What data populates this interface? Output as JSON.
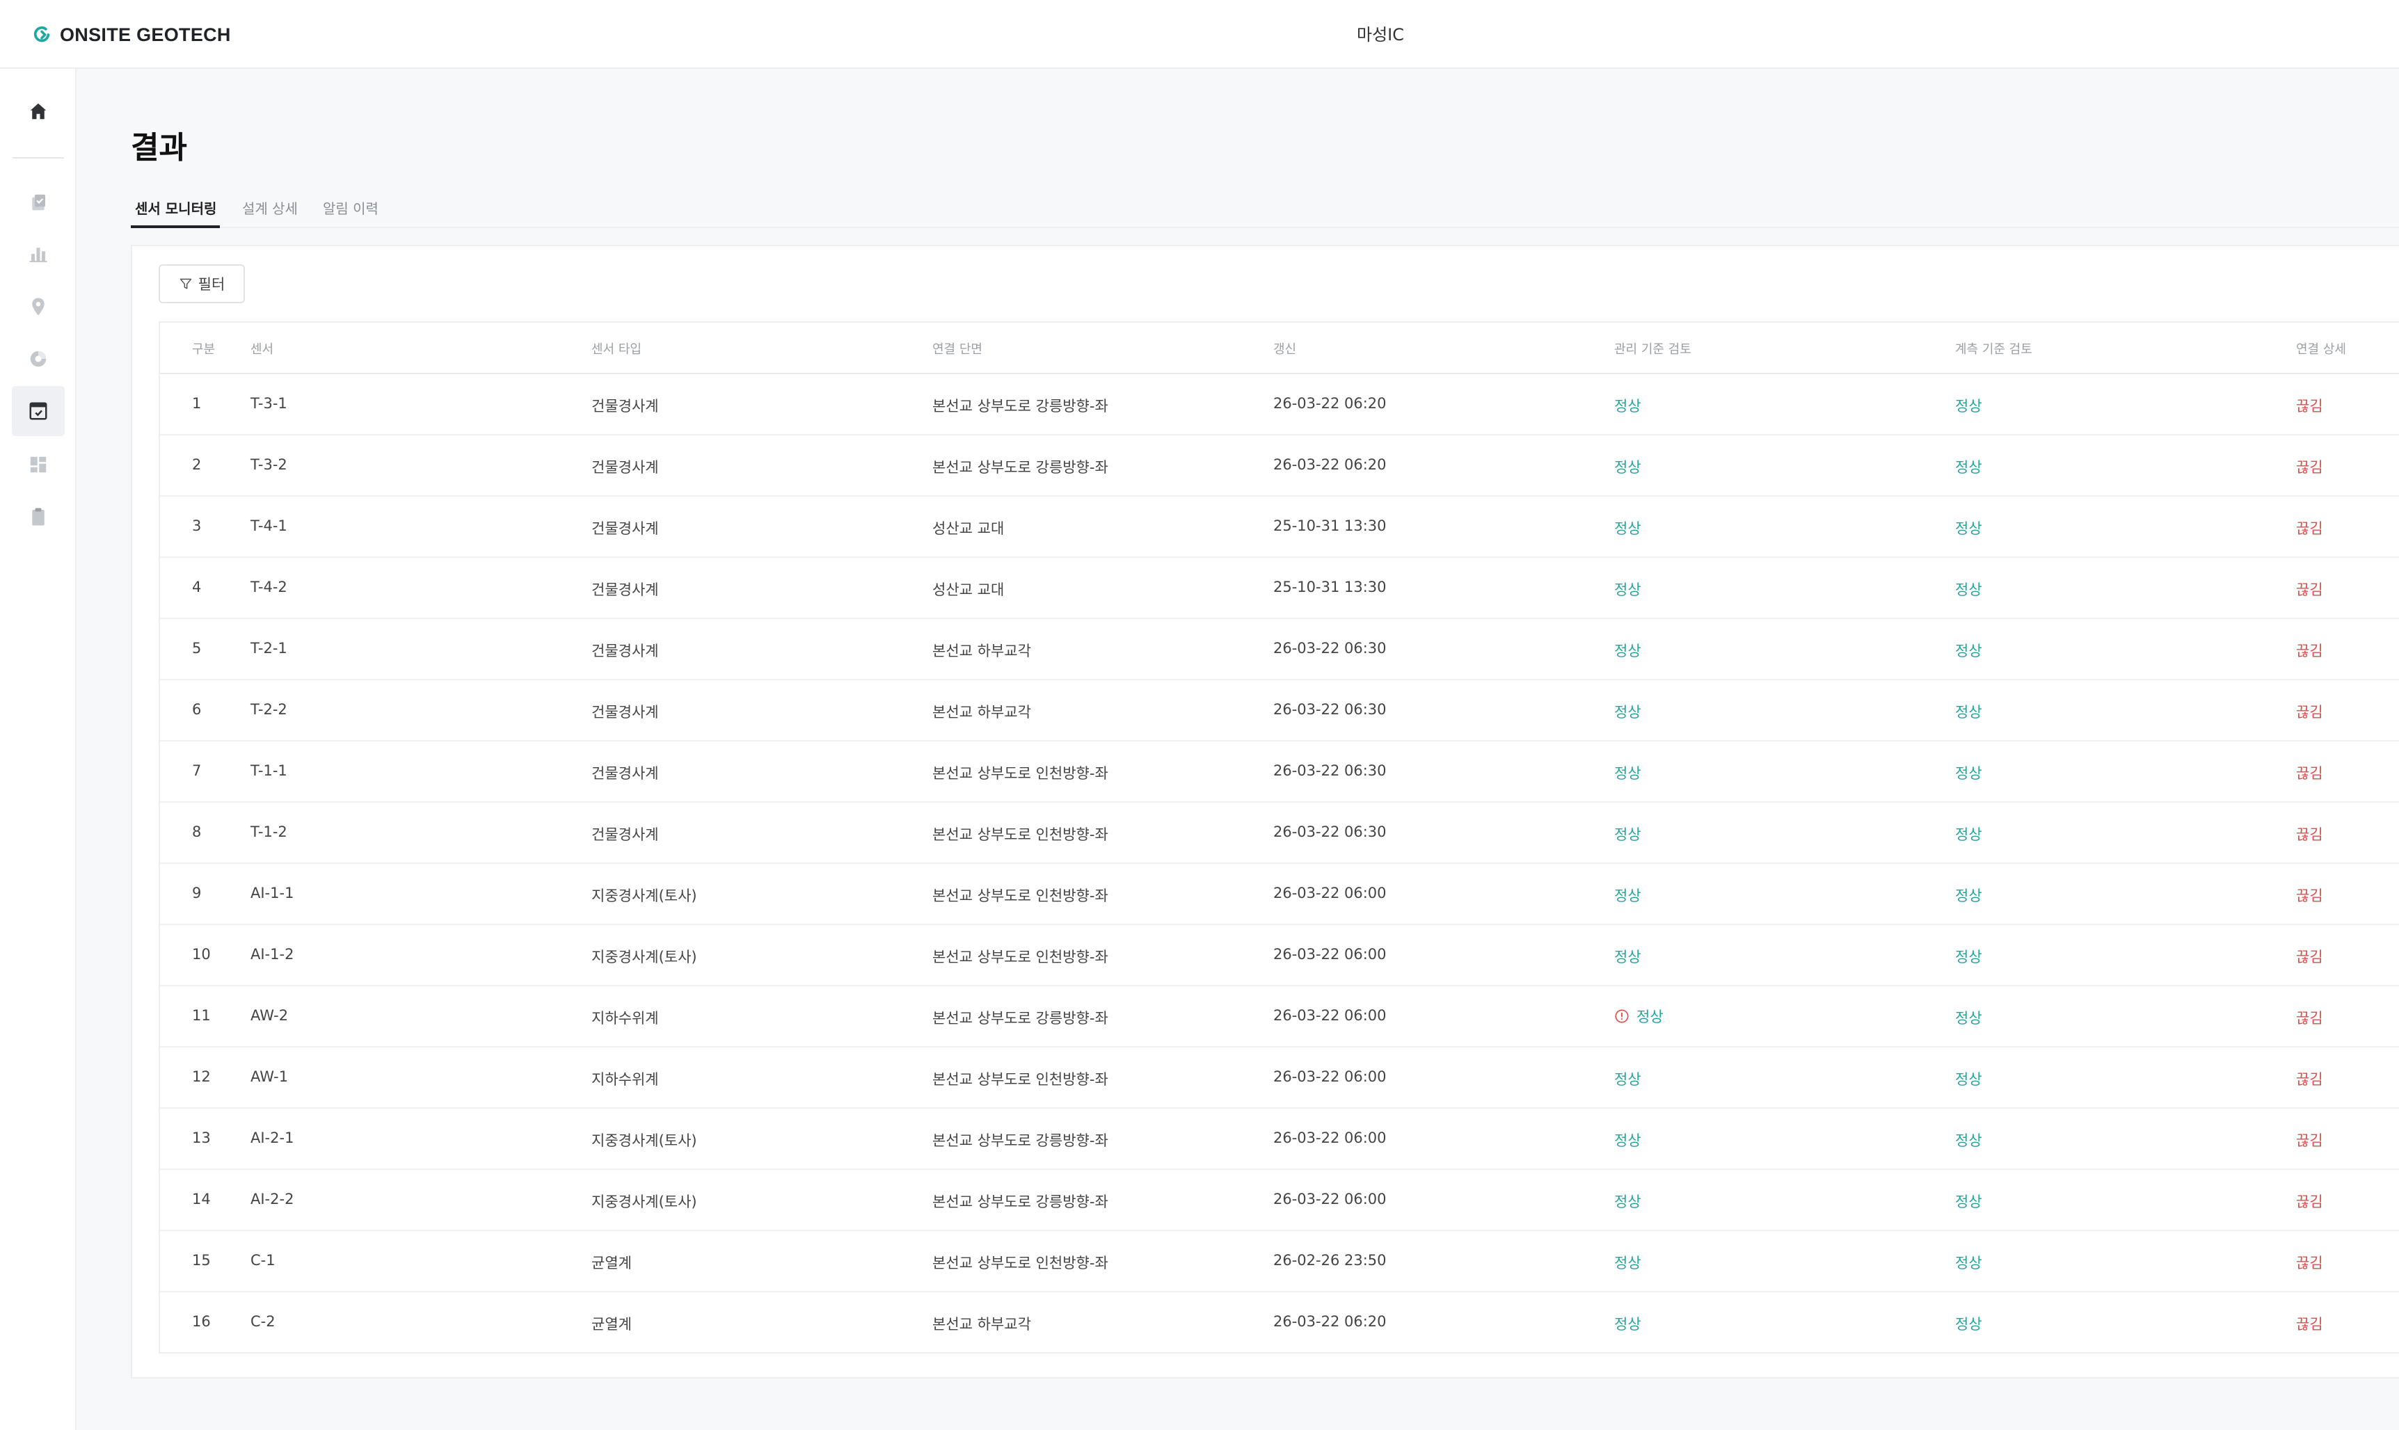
{
  "header": {
    "logo_text": "ONSITE GEOTECH",
    "project_title": "마성IC"
  },
  "sidebar": {
    "items": [
      {
        "icon": "home-icon",
        "active": false
      },
      {
        "icon": "checklist-icon",
        "active": false
      },
      {
        "icon": "bar-chart-icon",
        "active": false
      },
      {
        "icon": "location-pin-icon",
        "active": false
      },
      {
        "icon": "pie-chart-icon",
        "active": false
      },
      {
        "icon": "result-board-icon",
        "active": true
      },
      {
        "icon": "dashboard-grid-icon",
        "active": false
      },
      {
        "icon": "clipboard-icon",
        "active": false
      }
    ]
  },
  "page": {
    "title": "결과",
    "tabs": [
      {
        "label": "센서 모니터링",
        "active": true
      },
      {
        "label": "설계 상세",
        "active": false
      },
      {
        "label": "알림 이력",
        "active": false
      }
    ]
  },
  "filter": {
    "label": "필터",
    "icon": "filter-icon"
  },
  "table": {
    "columns": [
      "구분",
      "센서",
      "센서 타입",
      "연결 단면",
      "갱신",
      "관리 기준 검토",
      "계측 기준 검토",
      "연결 상세"
    ],
    "rows": [
      {
        "no": "1",
        "sensor": "T-3-1",
        "type": "건물경사계",
        "section": "본선교 상부도로 강릉방향-좌",
        "updated": "26-03-22 06:20",
        "mgmt": "정상",
        "mgmt_warn": false,
        "measure": "정상",
        "conn": "끊김"
      },
      {
        "no": "2",
        "sensor": "T-3-2",
        "type": "건물경사계",
        "section": "본선교 상부도로 강릉방향-좌",
        "updated": "26-03-22 06:20",
        "mgmt": "정상",
        "mgmt_warn": false,
        "measure": "정상",
        "conn": "끊김"
      },
      {
        "no": "3",
        "sensor": "T-4-1",
        "type": "건물경사계",
        "section": "성산교 교대",
        "updated": "25-10-31 13:30",
        "mgmt": "정상",
        "mgmt_warn": false,
        "measure": "정상",
        "conn": "끊김"
      },
      {
        "no": "4",
        "sensor": "T-4-2",
        "type": "건물경사계",
        "section": "성산교 교대",
        "updated": "25-10-31 13:30",
        "mgmt": "정상",
        "mgmt_warn": false,
        "measure": "정상",
        "conn": "끊김"
      },
      {
        "no": "5",
        "sensor": "T-2-1",
        "type": "건물경사계",
        "section": "본선교 하부교각",
        "updated": "26-03-22 06:30",
        "mgmt": "정상",
        "mgmt_warn": false,
        "measure": "정상",
        "conn": "끊김"
      },
      {
        "no": "6",
        "sensor": "T-2-2",
        "type": "건물경사계",
        "section": "본선교 하부교각",
        "updated": "26-03-22 06:30",
        "mgmt": "정상",
        "mgmt_warn": false,
        "measure": "정상",
        "conn": "끊김"
      },
      {
        "no": "7",
        "sensor": "T-1-1",
        "type": "건물경사계",
        "section": "본선교 상부도로 인천방향-좌",
        "updated": "26-03-22 06:30",
        "mgmt": "정상",
        "mgmt_warn": false,
        "measure": "정상",
        "conn": "끊김"
      },
      {
        "no": "8",
        "sensor": "T-1-2",
        "type": "건물경사계",
        "section": "본선교 상부도로 인천방향-좌",
        "updated": "26-03-22 06:30",
        "mgmt": "정상",
        "mgmt_warn": false,
        "measure": "정상",
        "conn": "끊김"
      },
      {
        "no": "9",
        "sensor": "AI-1-1",
        "type": "지중경사계(토사)",
        "section": "본선교 상부도로 인천방향-좌",
        "updated": "26-03-22 06:00",
        "mgmt": "정상",
        "mgmt_warn": false,
        "measure": "정상",
        "conn": "끊김"
      },
      {
        "no": "10",
        "sensor": "AI-1-2",
        "type": "지중경사계(토사)",
        "section": "본선교 상부도로 인천방향-좌",
        "updated": "26-03-22 06:00",
        "mgmt": "정상",
        "mgmt_warn": false,
        "measure": "정상",
        "conn": "끊김"
      },
      {
        "no": "11",
        "sensor": "AW-2",
        "type": "지하수위계",
        "section": "본선교 상부도로 강릉방향-좌",
        "updated": "26-03-22 06:00",
        "mgmt": "정상",
        "mgmt_warn": true,
        "measure": "정상",
        "conn": "끊김"
      },
      {
        "no": "12",
        "sensor": "AW-1",
        "type": "지하수위계",
        "section": "본선교 상부도로 인천방향-좌",
        "updated": "26-03-22 06:00",
        "mgmt": "정상",
        "mgmt_warn": false,
        "measure": "정상",
        "conn": "끊김"
      },
      {
        "no": "13",
        "sensor": "AI-2-1",
        "type": "지중경사계(토사)",
        "section": "본선교 상부도로 강릉방향-좌",
        "updated": "26-03-22 06:00",
        "mgmt": "정상",
        "mgmt_warn": false,
        "measure": "정상",
        "conn": "끊김"
      },
      {
        "no": "14",
        "sensor": "AI-2-2",
        "type": "지중경사계(토사)",
        "section": "본선교 상부도로 강릉방향-좌",
        "updated": "26-03-22 06:00",
        "mgmt": "정상",
        "mgmt_warn": false,
        "measure": "정상",
        "conn": "끊김"
      },
      {
        "no": "15",
        "sensor": "C-1",
        "type": "균열계",
        "section": "본선교 상부도로 인천방향-좌",
        "updated": "26-02-26 23:50",
        "mgmt": "정상",
        "mgmt_warn": false,
        "measure": "정상",
        "conn": "끊김"
      },
      {
        "no": "16",
        "sensor": "C-2",
        "type": "균열계",
        "section": "본선교 하부교각",
        "updated": "26-03-22 06:20",
        "mgmt": "정상",
        "mgmt_warn": false,
        "measure": "정상",
        "conn": "끊김"
      }
    ]
  },
  "colors": {
    "ok": "#21a6a1",
    "disconnected": "#e14b4b",
    "brand": "#21a6a1"
  }
}
